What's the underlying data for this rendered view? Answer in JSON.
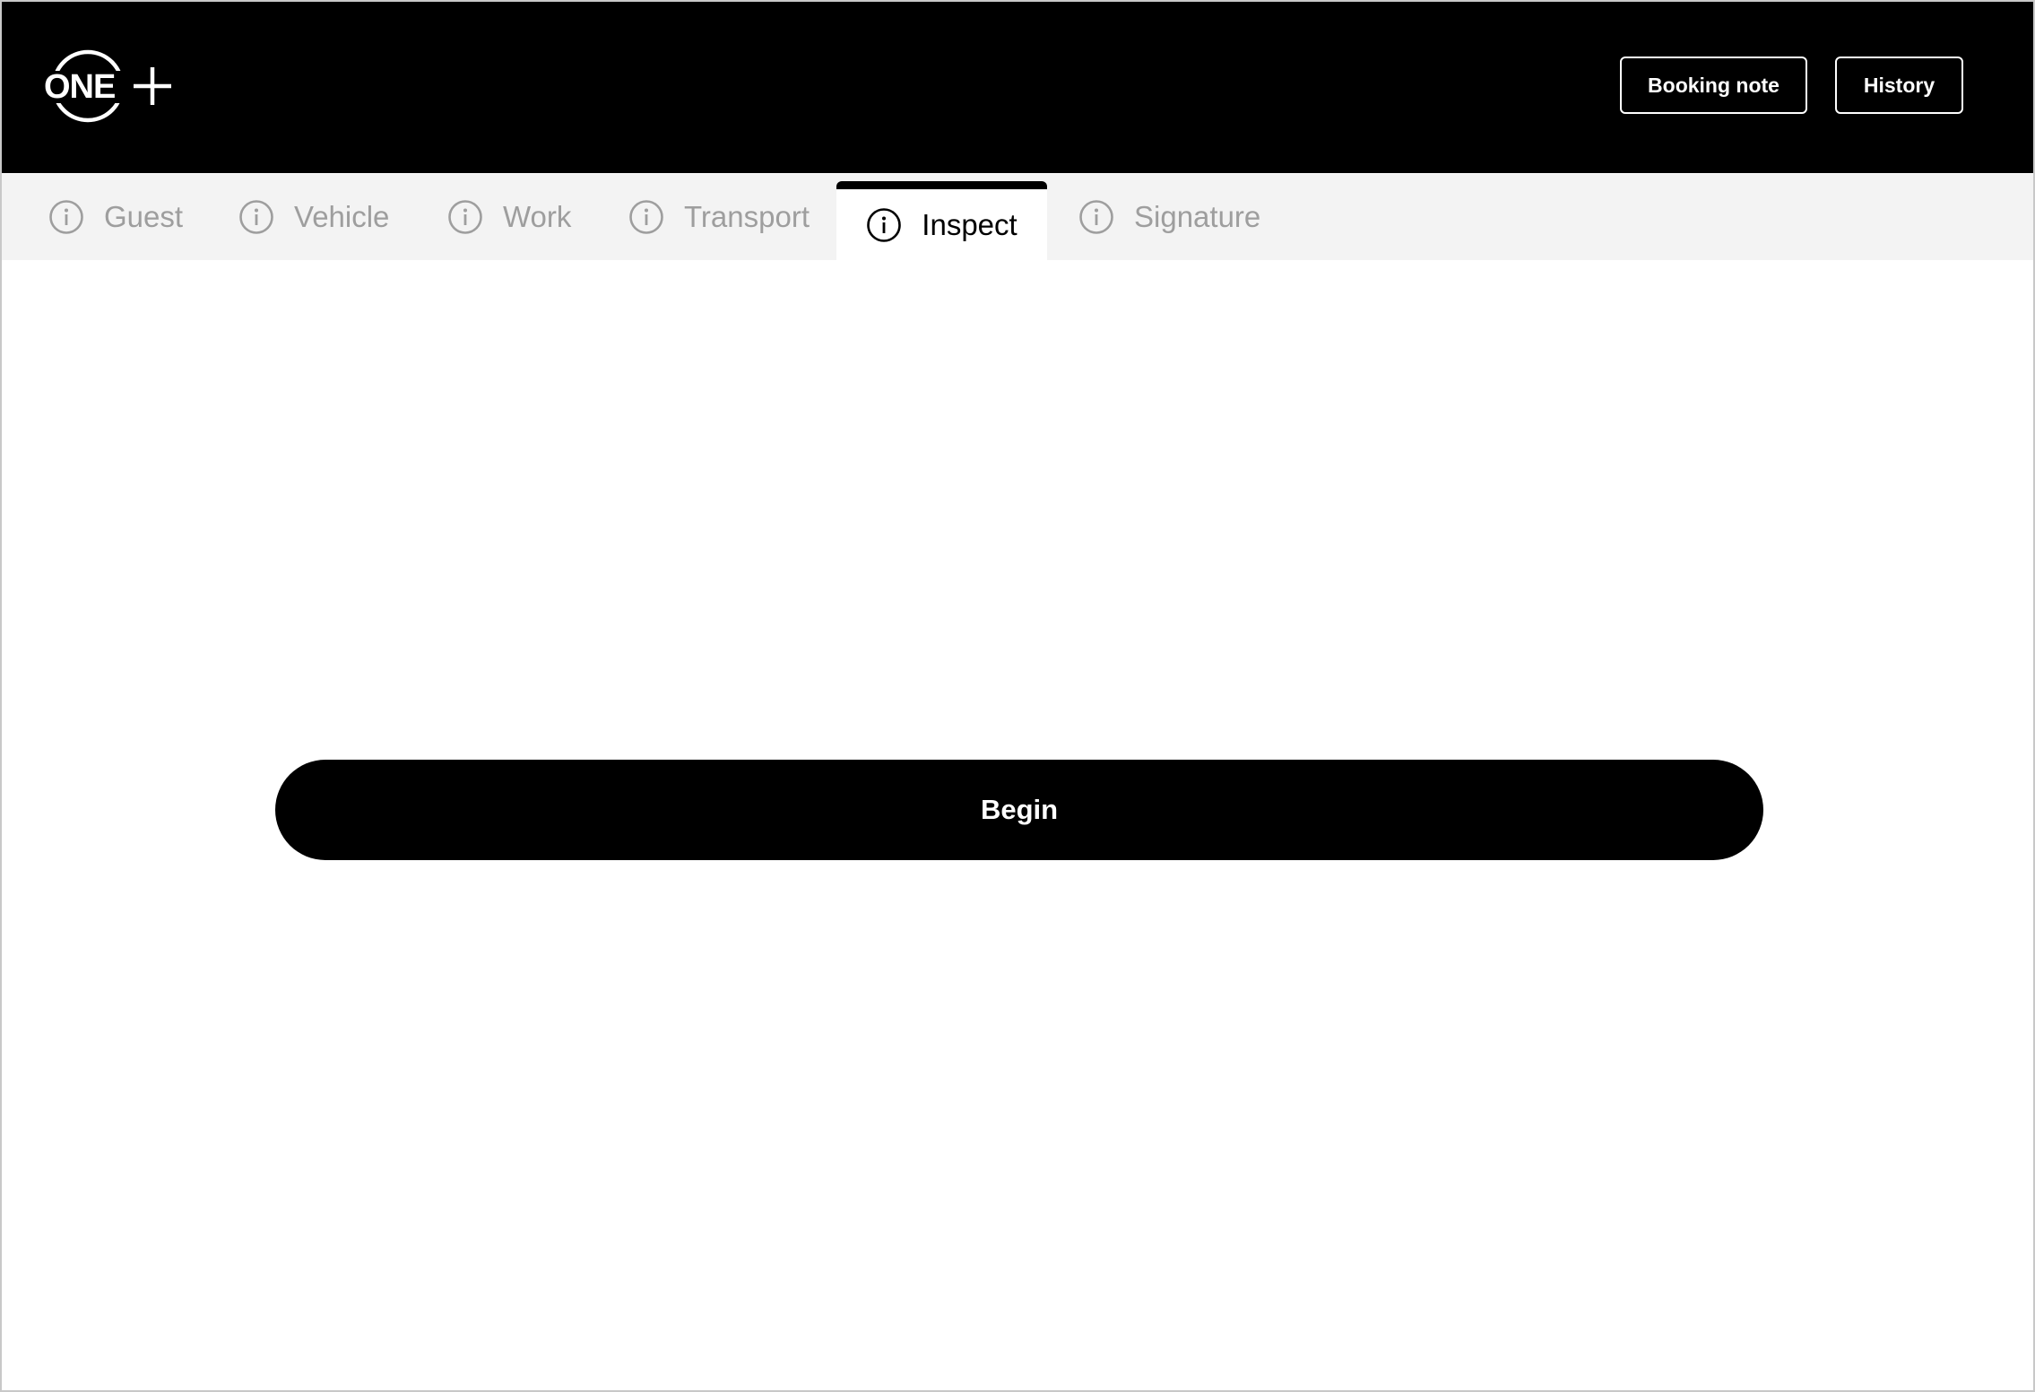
{
  "header": {
    "logo_text": "ONE+",
    "buttons": {
      "booking_note": "Booking note",
      "history": "History"
    }
  },
  "tabs": [
    {
      "label": "Guest",
      "icon": "info-icon",
      "active": false
    },
    {
      "label": "Vehicle",
      "icon": "info-icon",
      "active": false
    },
    {
      "label": "Work",
      "icon": "info-icon",
      "active": false
    },
    {
      "label": "Transport",
      "icon": "info-icon",
      "active": false
    },
    {
      "label": "Inspect",
      "icon": "info-icon",
      "active": true
    },
    {
      "label": "Signature",
      "icon": "info-icon",
      "active": false
    }
  ],
  "main": {
    "begin_label": "Begin"
  },
  "colors": {
    "header_bg": "#000000",
    "tabbar_bg": "#f3f3f3",
    "tab_inactive": "#9e9e9e",
    "tab_active": "#000000",
    "primary_button": "#000000"
  }
}
